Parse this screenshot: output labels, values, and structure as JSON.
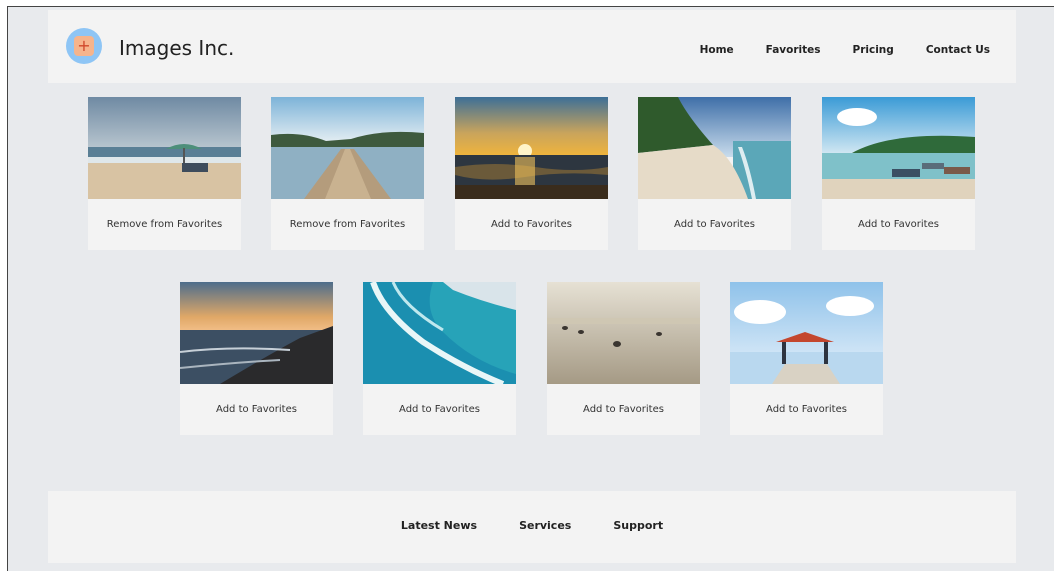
{
  "header": {
    "brand": "Images Inc.",
    "logo_icon": "plus-icon",
    "nav": [
      "Home",
      "Favorites",
      "Pricing",
      "Contact Us"
    ]
  },
  "gallery": [
    {
      "image": "beach-umbrella-photo",
      "action": "Remove from Favorites"
    },
    {
      "image": "lake-pier-photo",
      "action": "Remove from Favorites"
    },
    {
      "image": "ocean-sunset-photo",
      "action": "Add to Favorites"
    },
    {
      "image": "tropical-beach-photo",
      "action": "Add to Favorites"
    },
    {
      "image": "boats-bay-photo",
      "action": "Add to Favorites"
    },
    {
      "image": "coast-dusk-photo",
      "action": "Add to Favorites"
    },
    {
      "image": "aerial-waves-photo",
      "action": "Add to Favorites"
    },
    {
      "image": "shore-birds-photo",
      "action": "Add to Favorites"
    },
    {
      "image": "pier-gazebo-photo",
      "action": "Add to Favorites"
    }
  ],
  "footer": {
    "links": [
      "Latest News",
      "Services",
      "Support"
    ]
  }
}
